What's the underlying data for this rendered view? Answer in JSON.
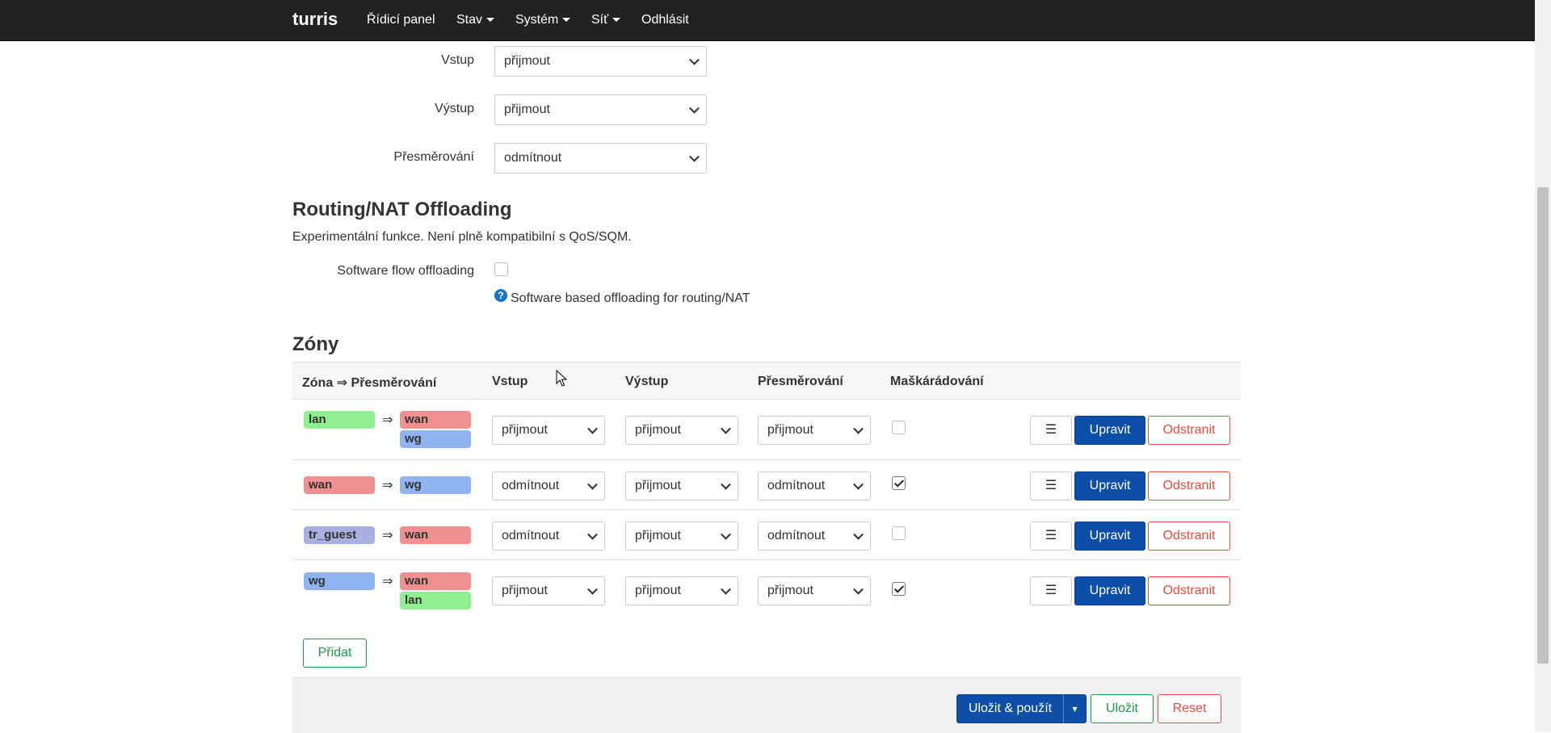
{
  "navbar": {
    "brand": "turris",
    "items": [
      "Řídicí panel",
      "Stav",
      "Systém",
      "Síť",
      "Odhlásit"
    ]
  },
  "defaults": {
    "input_label": "Vstup",
    "input_value": "přijmout",
    "output_label": "Výstup",
    "output_value": "přijmout",
    "forward_label": "Přesměrování",
    "forward_value": "odmítnout"
  },
  "offloading": {
    "title": "Routing/NAT Offloading",
    "description": "Experimentální funkce. Není plně kompatibilní s QoS/SQM.",
    "software_label": "Software flow offloading",
    "software_checked": false,
    "help_text": "Software based offloading for routing/NAT"
  },
  "zones": {
    "title": "Zóny",
    "headers": [
      "Zóna ⇒ Přesměrování",
      "Vstup",
      "Výstup",
      "Přesměrování",
      "Maškárádování"
    ],
    "arrow": "⇒",
    "rows": [
      {
        "zone": "lan",
        "targets": [
          "wan",
          "wg"
        ],
        "input": "přijmout",
        "output": "přijmout",
        "forward": "přijmout",
        "masq": false
      },
      {
        "zone": "wan",
        "targets": [
          "wg"
        ],
        "input": "odmítnout",
        "output": "přijmout",
        "forward": "odmítnout",
        "masq": true
      },
      {
        "zone": "tr_guest",
        "targets": [
          "wan"
        ],
        "input": "odmítnout",
        "output": "přijmout",
        "forward": "odmítnout",
        "masq": false
      },
      {
        "zone": "wg",
        "targets": [
          "wan",
          "lan"
        ],
        "input": "přijmout",
        "output": "přijmout",
        "forward": "přijmout",
        "masq": true
      }
    ],
    "menu_label": "☰",
    "edit_label": "Upravit",
    "delete_label": "Odstranit",
    "add_label": "Přidat"
  },
  "footer": {
    "save_apply_label": "Uložit & použít",
    "dropdown_caret": "▾",
    "save_label": "Uložit",
    "reset_label": "Reset"
  },
  "colors": {
    "navbar": "#222222",
    "primary": "#0d4fa8",
    "danger": "#e74c3c",
    "success": "#1a9a4a",
    "zone_lan": "#90f090",
    "zone_wan": "#f09090",
    "zone_wg": "#90b4f0",
    "zone_guest": "#a8b0e0"
  }
}
